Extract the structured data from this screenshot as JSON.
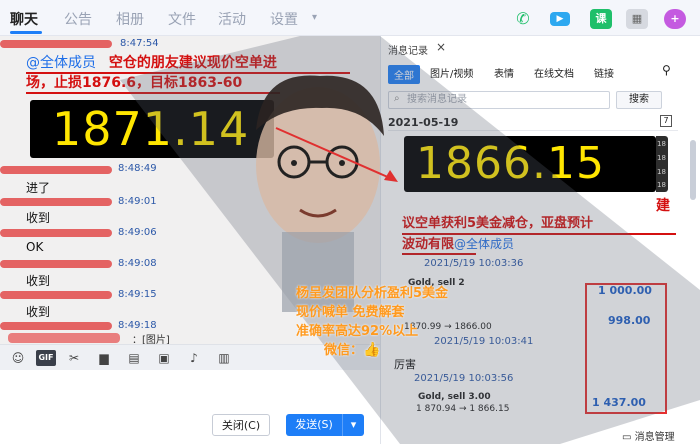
{
  "tabs": {
    "chat": "聊天",
    "notice": "公告",
    "album": "相册",
    "files": "文件",
    "activity": "活动",
    "settings": "设置"
  },
  "top_icons": {
    "homework": "课"
  },
  "chat": {
    "timestamps": [
      "8:47:54",
      "8:48:49",
      "8:49:01",
      "8:49:06",
      "8:49:08",
      "8:49:15",
      "8:49:18"
    ],
    "messages": [
      "进了",
      "收到",
      "OK",
      "收到",
      "收到"
    ],
    "mention_all": "@全体成员",
    "callout_line1": "空仓的朋友建议现价空单进",
    "callout_line2": "场，止损1876.6，目标1863-60",
    "ticker1": "1871.14",
    "image_tag": "：[图片]"
  },
  "toolbar": {
    "gif": "GIF",
    "close_label": "关闭(C)",
    "send_label": "发送(S)"
  },
  "history": {
    "title": "消息记录",
    "close": "×",
    "filters": [
      "全部",
      "图片/视频",
      "表情",
      "在线文档",
      "链接"
    ],
    "search_placeholder": "搜索消息记录",
    "search_button": "搜索",
    "date": "2021-05-19",
    "calendar_day": "7",
    "ticker2": "1866.15",
    "ticker2_side": [
      "18",
      "18",
      "18",
      "18"
    ],
    "callout_jian": "建",
    "callout_line1": "议空单获利5美金减仓，亚盘预计",
    "callout_line2_a": "波动有限",
    "callout_line2_mention": "@全体成员",
    "ts1": "2021/5/19 10:03:36",
    "trade1_name": "Gold, sell 2",
    "trade1_prices": "1870.99 → 1866.00",
    "trade1_amount": "1 000.00",
    "amount2": "998.00",
    "ts2": "2021/5/19 10:03:41",
    "ts3": "2021/5/19 10:03:56",
    "lihai": "厉害",
    "trade3_name": "Gold, sell 3.00",
    "trade3_prices": "1 870.94 → 1 866.15",
    "trade3_amount": "1 437.00",
    "msg_manage": "消息管理"
  },
  "promo": {
    "line1": "杨呈发团队分析盈利5美金",
    "line2": "现价喊单   免费解套",
    "line3": "准确率高达92%以上",
    "line4": "微信："
  },
  "colors": {
    "accent": "#1e7ef7",
    "callout_red": "#d41010",
    "ticker_yellow": "#ffe600",
    "promo_orange": "#ff9a1f"
  }
}
